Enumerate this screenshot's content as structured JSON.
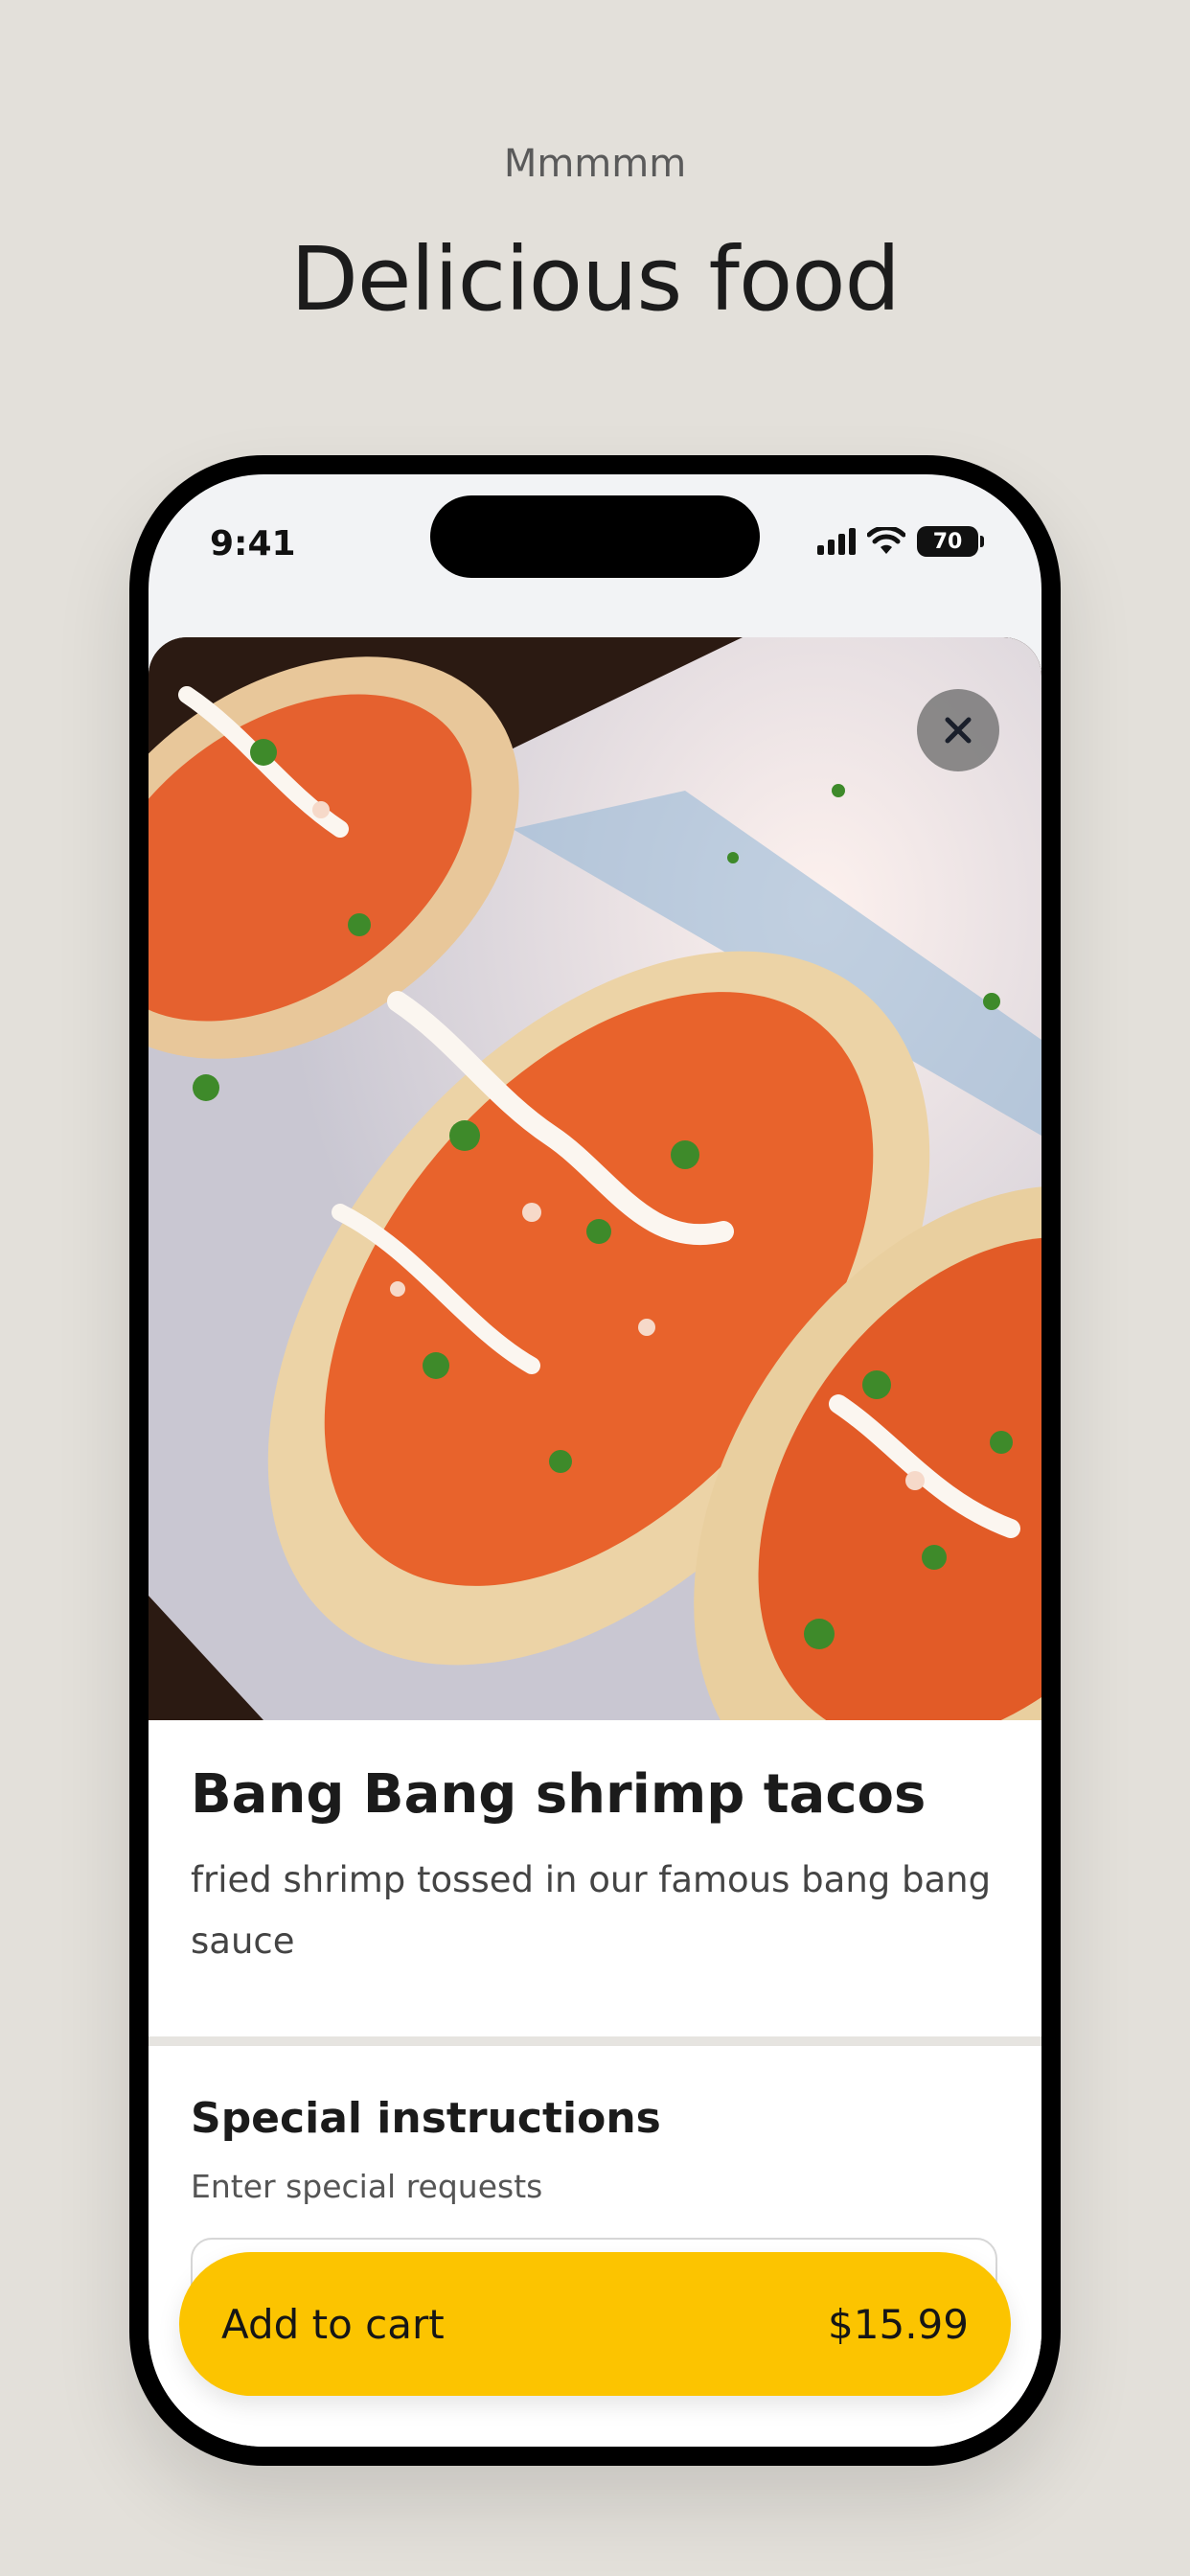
{
  "header": {
    "eyebrow": "Mmmmm",
    "headline": "Delicious food"
  },
  "status_bar": {
    "time": "9:41",
    "battery": "70",
    "icons": [
      "cellular-signal-icon",
      "wifi-icon",
      "battery-icon"
    ]
  },
  "item": {
    "image_icon": "food-photo",
    "close_icon": "close-icon",
    "title": "Bang Bang shrimp tacos",
    "description": "fried shrimp tossed in our famous bang bang sauce"
  },
  "special_instructions": {
    "title": "Special instructions",
    "subtitle": "Enter special requests",
    "value": ""
  },
  "cart_button": {
    "label": "Add to cart",
    "price": "$15.99"
  },
  "colors": {
    "background": "#e3e0da",
    "accent": "#fcc400",
    "text": "#1b1b1b"
  }
}
